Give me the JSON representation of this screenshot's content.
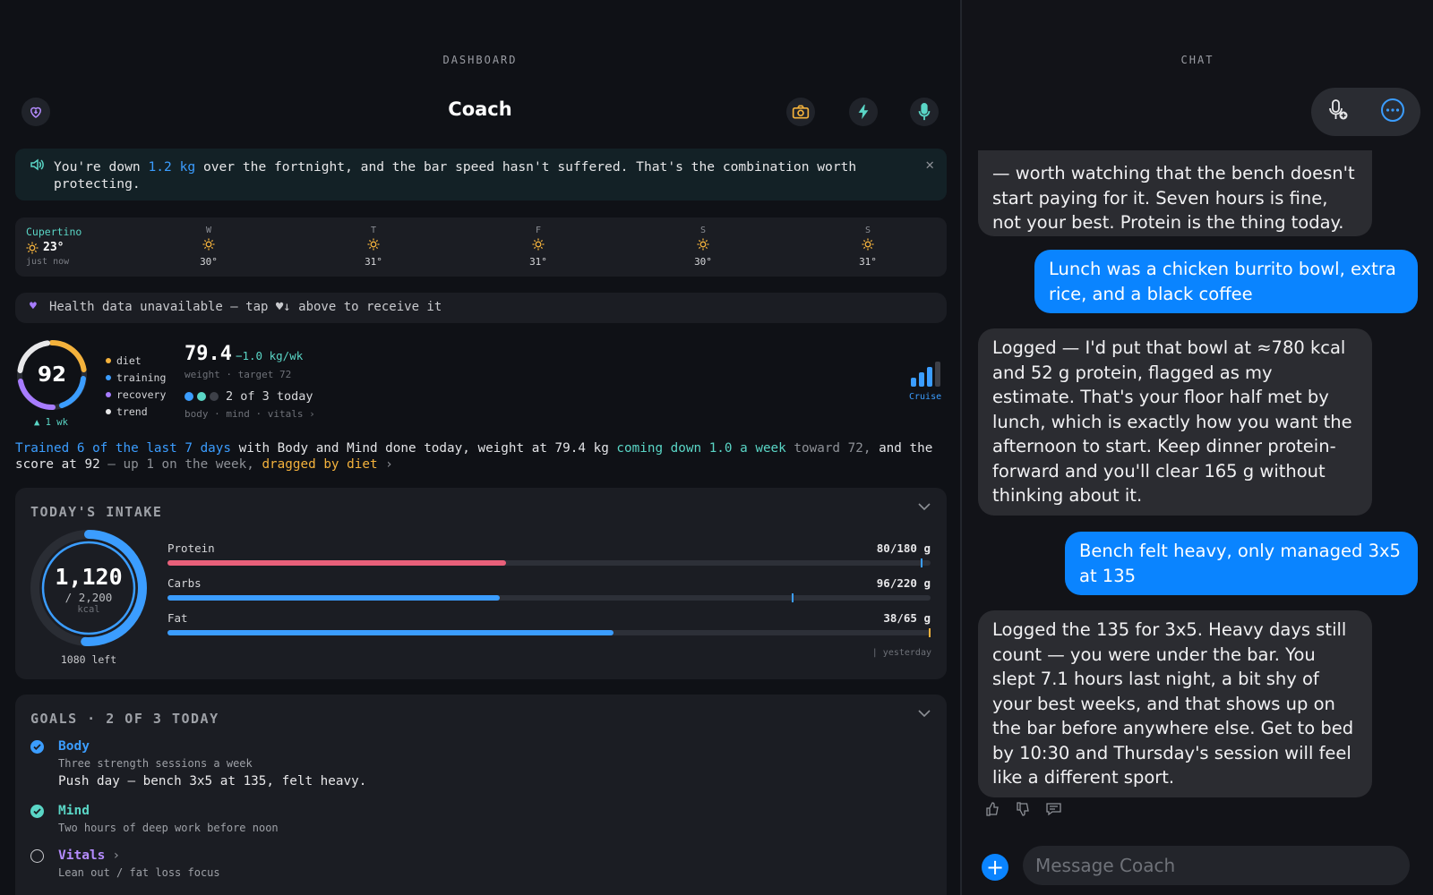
{
  "dashboard": {
    "section_label": "DASHBOARD",
    "title": "Coach",
    "banner": {
      "pre": "You're down ",
      "highlight": "1.2 kg",
      "post": " over the fortnight, and the bar speed hasn't suffered. That's the combination worth protecting."
    },
    "weather": {
      "city": "Cupertino",
      "current_temp": "23°",
      "updated": "just now",
      "days": [
        {
          "day": "W",
          "temp": "30°"
        },
        {
          "day": "T",
          "temp": "31°"
        },
        {
          "day": "F",
          "temp": "31°"
        },
        {
          "day": "S",
          "temp": "30°"
        },
        {
          "day": "S",
          "temp": "31°"
        }
      ]
    },
    "health_notice": "Health data unavailable — tap ♥↓ above to receive it",
    "score": {
      "value": "92",
      "change": "▲ 1 wk",
      "legend": [
        {
          "label": "diet",
          "color": "#f4b23c"
        },
        {
          "label": "training",
          "color": "#3b9dff"
        },
        {
          "label": "recovery",
          "color": "#a77cff"
        },
        {
          "label": "trend",
          "color": "#e8e8ea"
        }
      ]
    },
    "weight": {
      "value": "79.4",
      "rate": "−1.0 kg/wk",
      "sub": "weight · target 72",
      "today": "2 of 3 today",
      "footer": "body · mind · vitals ›"
    },
    "cruise_label": "Cruise",
    "summary": {
      "p1": "Trained 6 of the last 7 days",
      "p2": " with Body and Mind done today, ",
      "p3": "weight at 79.4 kg ",
      "p4": "coming down 1.0 a week",
      "p5": " toward 72, ",
      "p6": "and the score at 92",
      "p7": " — up 1 on the week, ",
      "p8": "dragged by diet",
      "p9": " ›"
    },
    "intake": {
      "header": "TODAY'S INTAKE",
      "kcal": "1,120",
      "kcal_of": "/ 2,200",
      "kcal_unit": "kcal",
      "left": "1080 left",
      "kcal_fraction": 0.51,
      "yesterday_label": "| yesterday",
      "macros": [
        {
          "name": "Protein",
          "value": "80/180 g",
          "fraction": 0.444,
          "yesterday": 0.99,
          "color": "#e9607a",
          "mark_color": "#3b9dff"
        },
        {
          "name": "Carbs",
          "value": "96/220 g",
          "fraction": 0.436,
          "yesterday": 0.82,
          "color": "#3b9dff",
          "mark_color": "#3b9dff"
        },
        {
          "name": "Fat",
          "value": "38/65 g",
          "fraction": 0.584,
          "yesterday": 1.0,
          "color": "#3b9dff",
          "mark_color": "#f4b23c"
        }
      ]
    },
    "goals": {
      "header": "GOALS · 2 OF 3 TODAY",
      "items": [
        {
          "title": "Body",
          "desc": "Three strength sessions a week",
          "note": "Push day — bench 3x5 at 135, felt heavy.",
          "color": "#3b9dff"
        },
        {
          "title": "Mind",
          "desc": "Two hours of deep work before noon",
          "color": "#5ad6c6"
        },
        {
          "title": "Vitals",
          "arrow": "›",
          "desc": "Lean out / fat loss focus",
          "color": "#b58cff"
        }
      ]
    }
  },
  "chat": {
    "section_label": "CHAT",
    "messages": [
      {
        "role": "ai",
        "text": "— worth watching that the bench doesn't start paying for it. Seven hours is fine, not your best. Protein is the thing today."
      },
      {
        "role": "me",
        "text": "Lunch was a chicken burrito bowl, extra rice, and a black coffee"
      },
      {
        "role": "ai",
        "text": "Logged — I'd put that bowl at ≈780 kcal and 52 g protein, flagged as my estimate. That's your floor half met by lunch, which is exactly how you want the afternoon to start. Keep dinner protein-forward and you'll clear 165 g without thinking about it."
      },
      {
        "role": "me",
        "text": "Bench felt heavy, only managed 3x5 at 135"
      },
      {
        "role": "ai",
        "text": "Logged the 135 for 3x5. Heavy days still count — you were under the bar. You slept 7.1 hours last night, a bit shy of your best weeks, and that shows up on the bar before anywhere else. Get to bed by 10:30 and Thursday's session will feel like a different sport."
      }
    ],
    "composer_placeholder": "Message Coach"
  },
  "colors": {
    "accent_blue": "#3b9dff",
    "teal": "#5ad6c6",
    "amber": "#f4b23c",
    "purple": "#a77cff",
    "pink": "#e9607a",
    "imessage_blue": "#0a84ff"
  }
}
